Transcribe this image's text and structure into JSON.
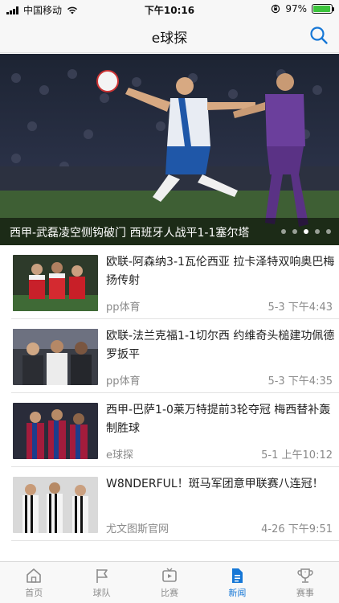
{
  "status_bar": {
    "carrier": "中国移动",
    "time": "下午10:16",
    "battery_percent": "97%",
    "battery_level": 0.97
  },
  "nav": {
    "title": "e球探",
    "search_icon": "search-icon"
  },
  "banner": {
    "caption": "西甲-武磊凌空侧钩破门 西班牙人战平1-1塞尔塔",
    "dots_total": 5,
    "active_dot": 3
  },
  "news": [
    {
      "title": "欧联-阿森纳3-1瓦伦西亚 拉卡泽特双响奥巴梅扬传射",
      "source": "pp体育",
      "time": "5-3 下午4:43"
    },
    {
      "title": "欧联-法兰克福1-1切尔西 约维奇头槌建功佩德罗扳平",
      "source": "pp体育",
      "time": "5-3 下午4:35"
    },
    {
      "title": "西甲-巴萨1-0莱万特提前3轮夺冠 梅西替补轰制胜球",
      "source": "e球探",
      "time": "5-1 上午10:12"
    },
    {
      "title": "W8NDERFUL！斑马军团意甲联赛八连冠！",
      "source": "尤文图斯官网",
      "time": "4-26 下午9:51"
    }
  ],
  "tabs": [
    {
      "label": "首页",
      "icon": "home-icon",
      "active": false
    },
    {
      "label": "球队",
      "icon": "flag-icon",
      "active": false
    },
    {
      "label": "比赛",
      "icon": "tv-icon",
      "active": false
    },
    {
      "label": "新闻",
      "icon": "news-icon",
      "active": true
    },
    {
      "label": "赛事",
      "icon": "trophy-icon",
      "active": false
    }
  ],
  "colors": {
    "accent": "#1677d6",
    "battery": "#3cc43c"
  }
}
